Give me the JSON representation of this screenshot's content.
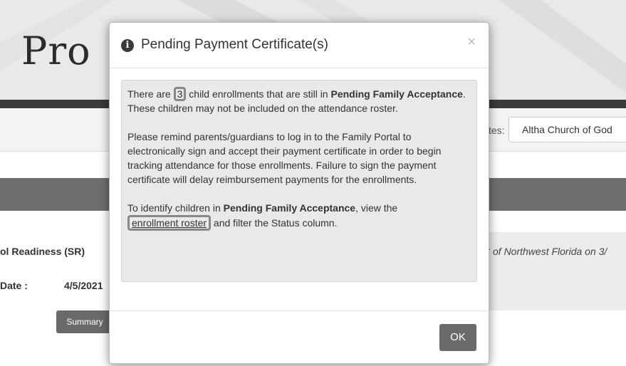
{
  "background": {
    "brand_fragment": "Pro",
    "sites_label": "tes:",
    "site_selected": "Altha Church of God",
    "sr_label": "ol Readiness (SR)",
    "date_label": "Date :",
    "date_value": "4/5/2021",
    "summary_button": "Summary",
    "right_note": "C of Northwest Florida on 3/"
  },
  "modal": {
    "title": "Pending Payment Certificate(s)",
    "close_glyph": "×",
    "info_glyph": "i",
    "p1_before": "There are ",
    "p1_count": "3",
    "p1_after": " child enrollments that are still in ",
    "p1_bold": "Pending Family Acceptance",
    "p1_end": ". These children may not be included on the attendance roster.",
    "p2": "Please remind parents/guardians to log in to the Family Portal to electronically sign and accept their payment certificate in order to begin tracking attendance for those enrollments. Failure to sign the payment certificate will delay reimbursement payments for the enrollments.",
    "p3_before": "To identify children in ",
    "p3_bold": "Pending Family Acceptance",
    "p3_mid": ", view the ",
    "p3_link": "enrollment roster",
    "p3_end": " and filter the Status column.",
    "ok_button": "OK"
  }
}
